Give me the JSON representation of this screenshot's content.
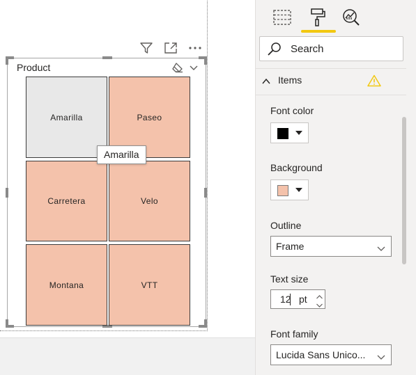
{
  "slicer": {
    "title": "Product",
    "tiles": [
      {
        "label": "Amarilla",
        "selected": true
      },
      {
        "label": "Paseo",
        "selected": false
      },
      {
        "label": "Carretera",
        "selected": false
      },
      {
        "label": "Velo",
        "selected": false
      },
      {
        "label": "Montana",
        "selected": false
      },
      {
        "label": "VTT",
        "selected": false
      }
    ],
    "tooltip": "Amarilla"
  },
  "visual_header": {
    "icons": [
      "filter-icon",
      "focus-mode-icon",
      "more-options-icon"
    ]
  },
  "format_pane": {
    "tabs": [
      "fields-tab",
      "format-tab",
      "analytics-tab"
    ],
    "active_tab": "format-tab",
    "search": {
      "placeholder": "Search"
    },
    "section": {
      "label": "Items",
      "expanded": true,
      "warning": true
    },
    "font_color": {
      "label": "Font color",
      "value": "#000000"
    },
    "background": {
      "label": "Background",
      "value": "#f4c2ab"
    },
    "outline": {
      "label": "Outline",
      "value": "Frame"
    },
    "text_size": {
      "label": "Text size",
      "value": "12",
      "unit": "pt"
    },
    "font_family": {
      "label": "Font family",
      "value": "Lucida Sans Unico..."
    }
  },
  "colors": {
    "tile_fill": "#f4c2ab",
    "tile_selected_fill": "#e8e8e8",
    "accent": "#f2c811",
    "warning": "#f2c811"
  }
}
